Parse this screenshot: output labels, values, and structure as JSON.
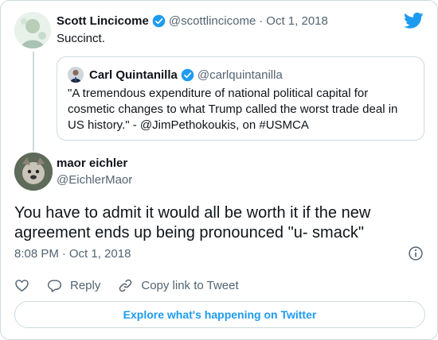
{
  "parent_tweet": {
    "author_name": "Scott Lincicome",
    "handle": "@scottlincicome",
    "date": "Oct 1, 2018",
    "separator": "·",
    "text": "Succinct.",
    "quoted_tweet": {
      "author_name": "Carl Quintanilla",
      "handle": "@carlquintanilla",
      "text": "\"A tremendous expenditure of national political capital for cosmetic changes to what Trump called the worst trade deal in US history.\" - @JimPethokoukis, on #USMCA"
    }
  },
  "main_tweet": {
    "author_name": "maor eichler",
    "handle": "@EichlerMaor",
    "text": "You have to admit it would all be worth it if the new agreement ends up being pronounced \"u- smack\"",
    "time": "8:08 PM",
    "separator": "·",
    "date": "Oct 1, 2018"
  },
  "actions": {
    "reply_label": "Reply",
    "copy_link_label": "Copy link to Tweet"
  },
  "footer": {
    "explore_label": "Explore what's happening on Twitter"
  },
  "icons": {
    "verified": "verified-badge-icon",
    "brand": "twitter-bird-icon",
    "info": "info-icon",
    "like": "heart-icon",
    "reply": "reply-bubble-icon",
    "copy_link": "link-icon"
  },
  "colors": {
    "accent": "#1d9bf0",
    "text": "#0f1419",
    "secondary_text": "#536471",
    "border": "#cfd9de"
  }
}
